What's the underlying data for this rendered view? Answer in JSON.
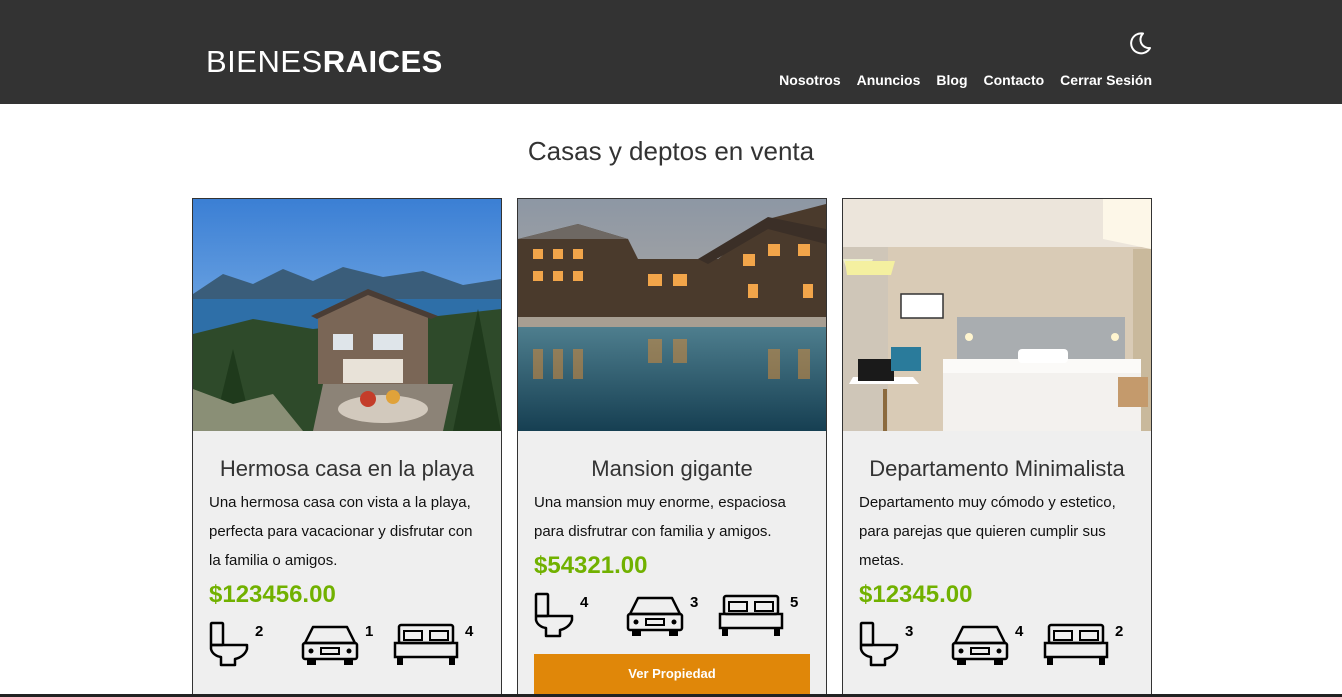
{
  "header": {
    "logo_light": "BIENES",
    "logo_bold": "RAICES",
    "dark_mode_icon": "moon-icon",
    "nav": [
      "Nosotros",
      "Anuncios",
      "Blog",
      "Contacto",
      "Cerrar Sesión"
    ]
  },
  "main": {
    "title": "Casas y deptos en venta",
    "cards": [
      {
        "title": "Hermosa casa en la playa",
        "description": "Una hermosa casa con vista a la playa, perfecta para vacacionar y disfrutar con la familia o amigos.",
        "price": "$123456.00",
        "baths": "2",
        "parking": "1",
        "rooms": "4"
      },
      {
        "title": "Mansion gigante",
        "description": "Una mansion muy enorme, espaciosa para disfrutrar con familia y amigos.",
        "price": "$54321.00",
        "baths": "4",
        "parking": "3",
        "rooms": "5",
        "button": "Ver Propiedad"
      },
      {
        "title": "Departamento Minimalista",
        "description": "Departamento muy cómodo y estetico, para parejas que quieren cumplir sus metas.",
        "price": "$12345.00",
        "baths": "3",
        "parking": "4",
        "rooms": "2"
      }
    ]
  },
  "colors": {
    "header_bg": "#333333",
    "price": "#71b100",
    "button": "#e08709",
    "card_bg": "#efefef"
  }
}
